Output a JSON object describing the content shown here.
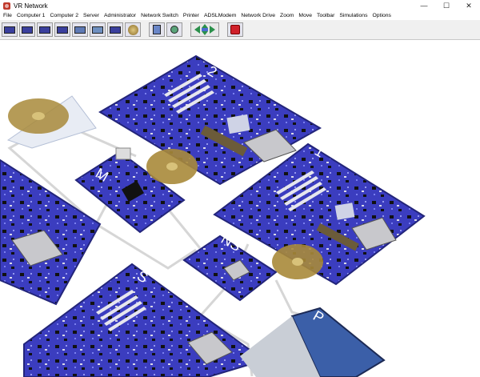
{
  "window": {
    "title": "VR Network",
    "minimize_glyph": "—",
    "maximize_glyph": "☐",
    "close_glyph": "✕"
  },
  "menu": {
    "items": [
      "File",
      "Computer 1",
      "Computer 2",
      "Server",
      "Administrator",
      "Network Switch",
      "Printer",
      "ADSLModem",
      "Network Drive",
      "Zoom",
      "Move",
      "Toolbar",
      "Simulations",
      "Options"
    ]
  },
  "toolbar": {
    "buttons": [
      "computer-1",
      "computer-2",
      "server",
      "administrator",
      "network-switch",
      "printer",
      "adsl-modem",
      "network-drive",
      "zoom-in",
      "zoom-out",
      "move",
      "stop"
    ]
  },
  "scene": {
    "board_labels": {
      "computer_2": "2",
      "computer_1": "1",
      "administrator": "M",
      "network_switch": "NS",
      "server": "S",
      "printer": "P"
    },
    "colors": {
      "board": "#3b3dbf",
      "board_edge": "#23257a",
      "cable": "#d6d6d6",
      "disk": "#a88a3a"
    }
  }
}
